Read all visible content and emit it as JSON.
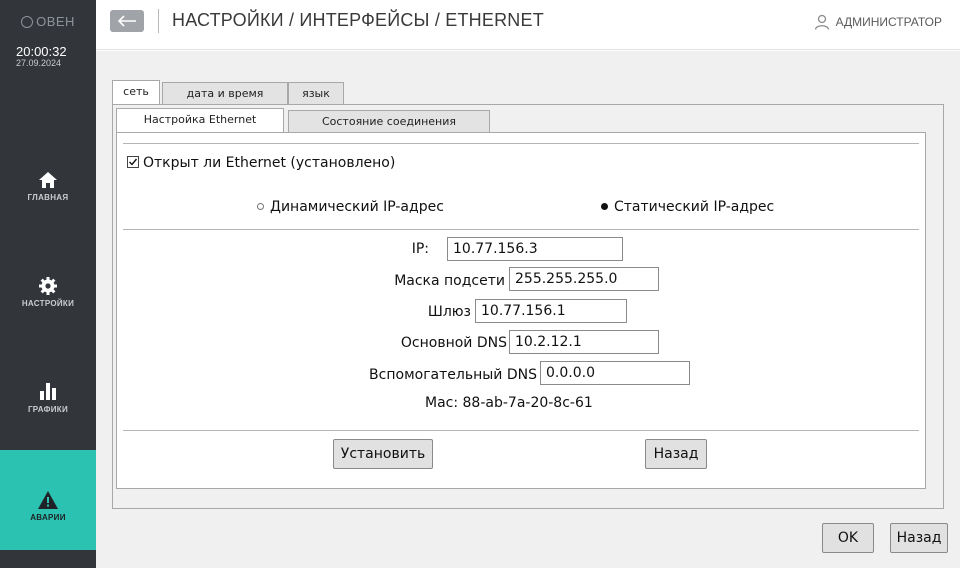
{
  "sidebar": {
    "logo": "ОВЕН",
    "time": "20:00:32",
    "date": "27.09.2024",
    "nav": [
      {
        "label": "ГЛАВНАЯ",
        "icon": "home-icon"
      },
      {
        "label": "НАСТРОЙКИ",
        "icon": "gear-icon"
      },
      {
        "label": "ГРАФИКИ",
        "icon": "chart-icon"
      },
      {
        "label": "АВАРИИ",
        "icon": "warning-icon"
      }
    ],
    "active_color": "#2bc2b2",
    "bg_color": "#323539"
  },
  "header": {
    "title": "НАСТРОЙКИ / ИНТЕРФЕЙСЫ / ETHERNET",
    "user": "АДМИНИСТРАТОР"
  },
  "tabs": {
    "top": [
      "сеть",
      "дата и время",
      "язык"
    ],
    "active_top": "сеть",
    "sub": [
      "Настройка Ethernet",
      "Состояние соединения"
    ],
    "active_sub": "Настройка Ethernet"
  },
  "ethernet": {
    "enabled_label": "Открыт ли Ethernet (установлено)",
    "enabled": true,
    "radio_dynamic": "Динамический IP-адрес",
    "radio_static": "Статический IP-адрес",
    "mode": "static",
    "fields": {
      "ip": {
        "label": "IP:",
        "value": "10.77.156.3"
      },
      "mask": {
        "label": "Маска подсети",
        "value": "255.255.255.0"
      },
      "gateway": {
        "label": "Шлюз",
        "value": "10.77.156.1"
      },
      "dns1": {
        "label": "Основной DNS",
        "value": "10.2.12.1"
      },
      "dns2": {
        "label": "Вспомогательный DNS",
        "value": "0.0.0.0"
      }
    },
    "mac": "Mac: 88-ab-7a-20-8c-61",
    "apply_label": "Установить",
    "back_label": "Назад"
  },
  "footer": {
    "ok_label": "OK",
    "back_label": "Назад"
  }
}
